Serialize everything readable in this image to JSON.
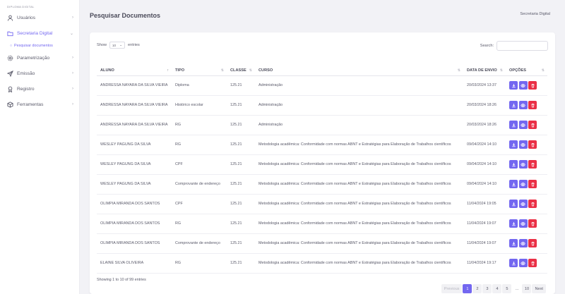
{
  "brand": "DIPLOMA DIGITAL",
  "sidebar": {
    "items": [
      {
        "label": "Usuários",
        "icon": "user-icon",
        "chevron": "›"
      },
      {
        "label": "Secretaria Digital",
        "icon": "folder-icon",
        "chevron": "⌄",
        "active": true
      },
      {
        "label": "Parametrização",
        "icon": "gear-icon",
        "chevron": "›"
      },
      {
        "label": "Emissão",
        "icon": "send-icon",
        "chevron": "›"
      },
      {
        "label": "Registro",
        "icon": "award-icon",
        "chevron": "›"
      },
      {
        "label": "Ferramentas",
        "icon": "box-icon",
        "chevron": "›"
      }
    ],
    "subitem": "Pesquisar documentos"
  },
  "header": {
    "title": "Pesquisar Documentos",
    "user": "Secretaria Digital"
  },
  "table_controls": {
    "show_label": "Show",
    "show_value": "10",
    "entries_label": "entries",
    "search_label": "Search:"
  },
  "table": {
    "columns": [
      {
        "label": "ALUNO",
        "sort": "↑"
      },
      {
        "label": "TIPO",
        "sort": "⇅"
      },
      {
        "label": "CLASSE",
        "sort": "⇅"
      },
      {
        "label": "CURSO",
        "sort": "⇅"
      },
      {
        "label": "DATA DE ENVIO",
        "sort": "⇅"
      },
      {
        "label": "OPÇÕES",
        "sort": "⇅"
      }
    ],
    "rows": [
      {
        "aluno": "ANDRESSA NAYARA DA SILVA VIEIRA",
        "tipo": "Diploma",
        "classe": "125.21",
        "curso": "Administração",
        "data": "20/03/2024 13:37"
      },
      {
        "aluno": "ANDRESSA NAYARA DA SILVA VIEIRA",
        "tipo": "Histórico escolar",
        "classe": "125.21",
        "curso": "Administração",
        "data": "20/03/2024 18:26"
      },
      {
        "aluno": "ANDRESSA NAYARA DA SILVA VIEIRA",
        "tipo": "RG",
        "classe": "125.21",
        "curso": "Administração",
        "data": "20/03/2024 18:26"
      },
      {
        "aluno": "WESLEY PAGUNG DA SILVA",
        "tipo": "RG",
        "classe": "125.21",
        "curso": "Metodologia acadêmica: Conformidade com normas ABNT e Estratégias para Elaboração de Trabalhos científicos",
        "data": "09/04/2024 14:10"
      },
      {
        "aluno": "WESLEY PAGUNG DA SILVA",
        "tipo": "CPF",
        "classe": "125.21",
        "curso": "Metodologia acadêmica: Conformidade com normas ABNT e Estratégias para Elaboração de Trabalhos científicos",
        "data": "09/04/2024 14:10"
      },
      {
        "aluno": "WESLEY PAGUNG DA SILVA",
        "tipo": "Comprovante de endereço",
        "classe": "125.21",
        "curso": "Metodologia acadêmica: Conformidade com normas ABNT e Estratégias para Elaboração de Trabalhos científicos",
        "data": "09/04/2024 14:10"
      },
      {
        "aluno": "OLIMPIA MIRANDA DOS SANTOS",
        "tipo": "CPF",
        "classe": "125.21",
        "curso": "Metodologia acadêmica: Conformidade com normas ABNT e Estratégias para Elaboração de Trabalhos científicos",
        "data": "11/04/2024 19:05"
      },
      {
        "aluno": "OLIMPIA MIRANDA DOS SANTOS",
        "tipo": "RG",
        "classe": "125.21",
        "curso": "Metodologia acadêmica: Conformidade com normas ABNT e Estratégias para Elaboração de Trabalhos científicos",
        "data": "11/04/2024 19:07"
      },
      {
        "aluno": "OLIMPIA MIRANDA DOS SANTOS",
        "tipo": "Comprovante de endereço",
        "classe": "125.21",
        "curso": "Metodologia acadêmica: Conformidade com normas ABNT e Estratégias para Elaboração de Trabalhos científicos",
        "data": "11/04/2024 19:07"
      },
      {
        "aluno": "ELAINE SILVA OLIVEIRA",
        "tipo": "RG",
        "classe": "125.21",
        "curso": "Metodologia acadêmica: Conformidade com normas ABNT e Estratégias para Elaboração de Trabalhos científicos",
        "data": "11/04/2024 19:17"
      }
    ],
    "row_actions": [
      "download-icon",
      "eye-icon",
      "trash-icon"
    ]
  },
  "footer": {
    "info": "Showing 1 to 10 of 99 entries",
    "pagination": [
      "Previous",
      "1",
      "2",
      "3",
      "4",
      "5",
      "…",
      "10",
      "Next"
    ],
    "active_page": "1"
  },
  "colors": {
    "accent": "#7367f0",
    "danger": "#ea3046"
  }
}
